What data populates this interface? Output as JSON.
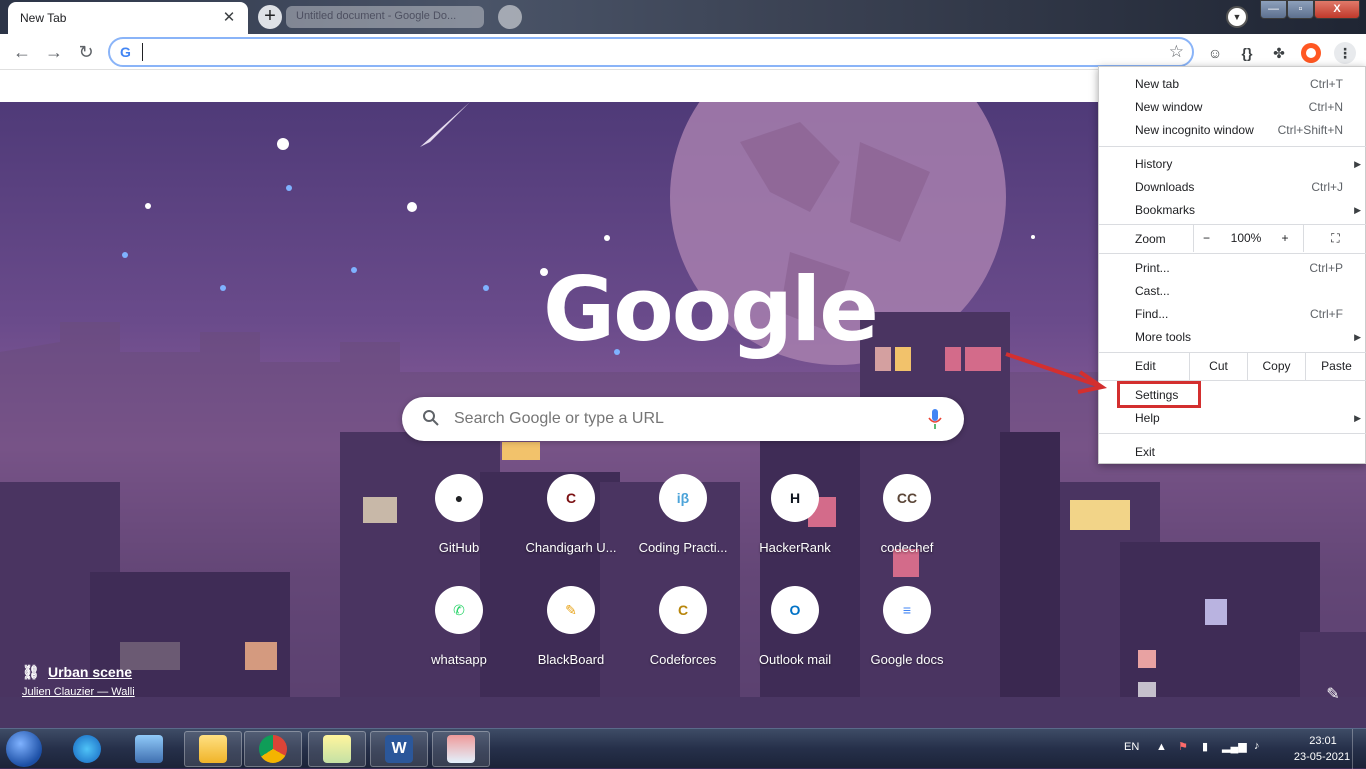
{
  "browser": {
    "active_tab_title": "New Tab",
    "inactive_tab_title": "Untitled document - Google Do...",
    "address_value": "",
    "window_controls": {
      "minimize": "—",
      "maximize": "▫",
      "close": "X"
    }
  },
  "ntp": {
    "logo_text": "Google",
    "search_placeholder": "Search Google or type a URL",
    "shortcuts": [
      {
        "label": "GitHub",
        "icon": "github-icon",
        "glyph": "●",
        "fg": "#202124"
      },
      {
        "label": "Chandigarh U...",
        "icon": "chandigarh-university-icon",
        "glyph": "C",
        "fg": "#7b1113"
      },
      {
        "label": "Coding Practi...",
        "icon": "coding-practice-icon",
        "glyph": "iβ",
        "fg": "#4ba3d9"
      },
      {
        "label": "HackerRank",
        "icon": "hackerrank-icon",
        "glyph": "H",
        "fg": "#0e141e"
      },
      {
        "label": "codechef",
        "icon": "codechef-icon",
        "glyph": "CC",
        "fg": "#5b4638"
      },
      {
        "label": "whatsapp",
        "icon": "whatsapp-icon",
        "glyph": "✆",
        "fg": "#25d366"
      },
      {
        "label": "BlackBoard",
        "icon": "blackboard-icon",
        "glyph": "✎",
        "fg": "#e8a317"
      },
      {
        "label": "Codeforces",
        "icon": "codeforces-icon",
        "glyph": "C",
        "fg": "#b8860b"
      },
      {
        "label": "Outlook mail",
        "icon": "outlook-icon",
        "glyph": "O",
        "fg": "#0072c6"
      },
      {
        "label": "Google docs",
        "icon": "google-docs-icon",
        "glyph": "≡",
        "fg": "#4285f4"
      }
    ],
    "attribution_title": "Urban scene",
    "attribution_artist": "Julien Clauzier — Walli"
  },
  "menu": {
    "new_tab": "New tab",
    "new_tab_sc": "Ctrl+T",
    "new_window": "New window",
    "new_window_sc": "Ctrl+N",
    "new_incognito": "New incognito window",
    "new_incognito_sc": "Ctrl+Shift+N",
    "history": "History",
    "downloads": "Downloads",
    "downloads_sc": "Ctrl+J",
    "bookmarks": "Bookmarks",
    "zoom": "Zoom",
    "zoom_minus": "−",
    "zoom_value": "100%",
    "zoom_plus": "+",
    "print": "Print...",
    "print_sc": "Ctrl+P",
    "cast": "Cast...",
    "find": "Find...",
    "find_sc": "Ctrl+F",
    "more_tools": "More tools",
    "edit": "Edit",
    "cut": "Cut",
    "copy": "Copy",
    "paste": "Paste",
    "settings": "Settings",
    "help": "Help",
    "exit": "Exit"
  },
  "taskbar": {
    "language": "EN",
    "time": "23:01",
    "date": "23-05-2021"
  },
  "colors": {
    "accent": "#1a73e8",
    "highlight": "#d32f2f"
  }
}
